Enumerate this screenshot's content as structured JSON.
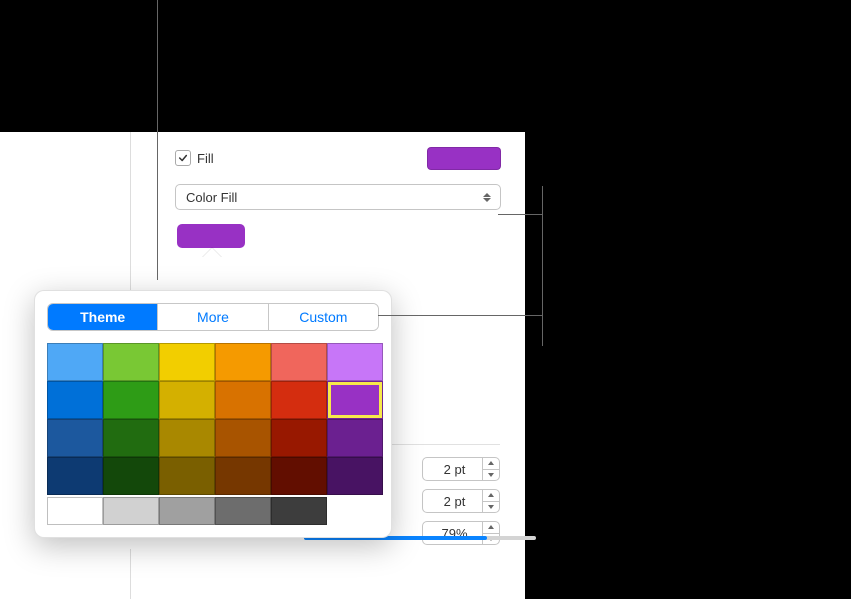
{
  "fill": {
    "checkbox_checked": true,
    "label": "Fill",
    "type_select": "Color Fill",
    "current_color": "#9831c4"
  },
  "popover": {
    "tabs": {
      "theme": "Theme",
      "more": "More",
      "custom": "Custom"
    },
    "active_tab": "theme",
    "rows": [
      [
        "#4fa8f6",
        "#79c834",
        "#f2ce00",
        "#f59a00",
        "#f0665c",
        "#c776f8"
      ],
      [
        "#0070d8",
        "#2e9c16",
        "#d4b000",
        "#d87200",
        "#d42d0f",
        "#9831c4"
      ],
      [
        "#1c589e",
        "#216c10",
        "#a98800",
        "#a85400",
        "#981800",
        "#6b2090"
      ],
      [
        "#0d3a72",
        "#13480a",
        "#7a5f00",
        "#763700",
        "#620e00",
        "#481363"
      ],
      [
        "#ffffff",
        "#d1d1d1",
        "#a0a0a0",
        "#6d6d6d",
        "#3d3d3d",
        "#ffffff"
      ]
    ],
    "selected": {
      "row": 1,
      "col": 5
    }
  },
  "steppers": {
    "pt1": "2 pt",
    "pt2": "2 pt",
    "opacity": "79%"
  }
}
